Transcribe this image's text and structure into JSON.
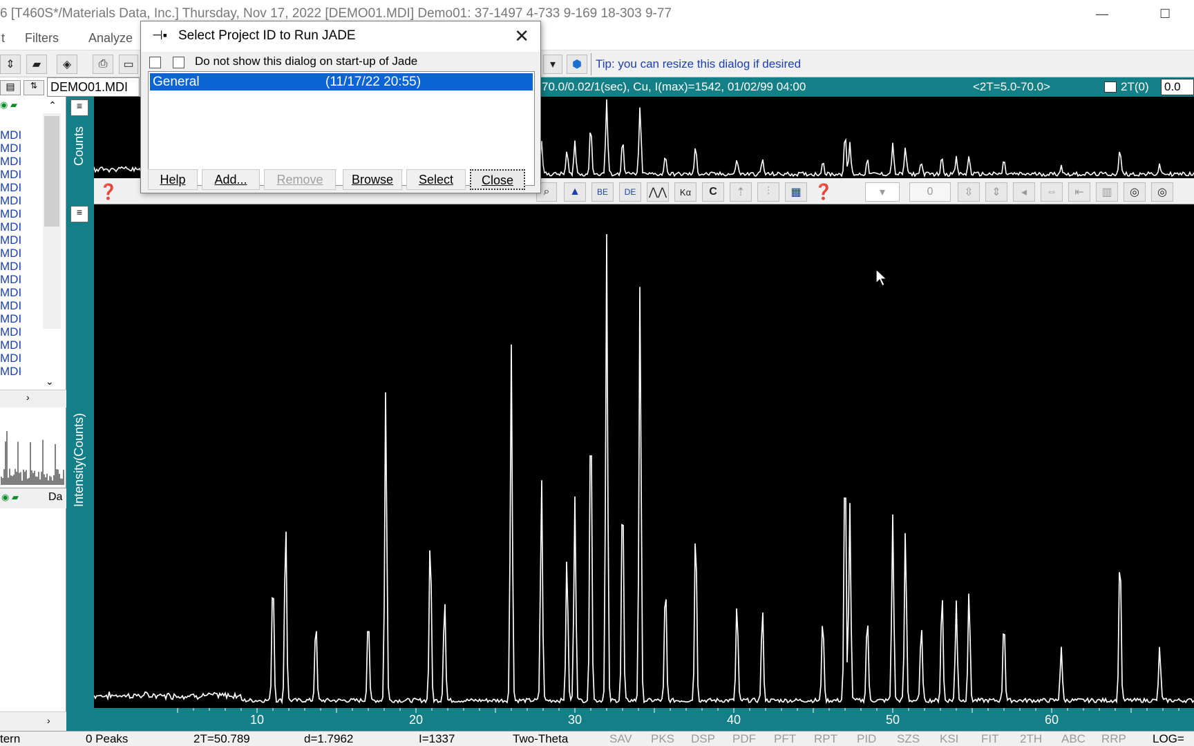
{
  "window": {
    "title": "6 [T460S*/Materials Data, Inc.] Thursday, Nov 17, 2022 [DEMO01.MDI] Demo01: 37-1497 4-733 9-169 18-303 9-77"
  },
  "menu": {
    "items": [
      "t",
      "Filters",
      "Analyze"
    ]
  },
  "toolbar": {
    "tip": "Tip: you can resize this dialog if desired"
  },
  "left_panel": {
    "file": "DEMO01.MDI",
    "items": [
      "MDI",
      "MDI",
      "MDI",
      "MDI",
      "MDI",
      "MDI",
      "MDI",
      "MDI",
      "MDI",
      "MDI",
      "MDI",
      "MDI",
      "MDI",
      "MDI",
      "MDI",
      "MDI",
      "MDI",
      "MDI",
      "MDI"
    ],
    "da_label": "Da"
  },
  "info_bar": {
    "scan": "70.0/0.02/1(sec), Cu, I(max)=1542, 01/02/99 04:00",
    "range": "<2T=5.0-70.0>",
    "offset_label": "2T(0)",
    "offset_value": "0.0"
  },
  "plot": {
    "top_ylabel": "Counts",
    "main_ylabel": "Intensity(Counts)",
    "x_ticks": [
      "10",
      "20",
      "30",
      "40",
      "50",
      "60"
    ],
    "stepper_value": "0"
  },
  "chart_data": {
    "type": "line",
    "xlabel": "",
    "ylabel": "Intensity(Counts)",
    "xlim": [
      5,
      70
    ],
    "ylim": [
      0,
      1600
    ],
    "peaks": [
      [
        11.0,
        430
      ],
      [
        11.8,
        610
      ],
      [
        13.7,
        270
      ],
      [
        17.0,
        290
      ],
      [
        18.1,
        1040
      ],
      [
        20.9,
        560
      ],
      [
        21.8,
        350
      ],
      [
        26.0,
        1180
      ],
      [
        27.9,
        740
      ],
      [
        29.5,
        480
      ],
      [
        30.0,
        680
      ],
      [
        31.0,
        1030
      ],
      [
        32.0,
        1540
      ],
      [
        33.0,
        730
      ],
      [
        34.1,
        1400
      ],
      [
        35.7,
        400
      ],
      [
        37.6,
        600
      ],
      [
        40.2,
        330
      ],
      [
        41.8,
        310
      ],
      [
        45.6,
        290
      ],
      [
        47.0,
        840
      ],
      [
        47.3,
        660
      ],
      [
        48.4,
        290
      ],
      [
        50.0,
        620
      ],
      [
        50.8,
        570
      ],
      [
        51.8,
        260
      ],
      [
        53.1,
        370
      ],
      [
        54.0,
        330
      ],
      [
        54.8,
        370
      ],
      [
        57.0,
        280
      ],
      [
        60.6,
        180
      ],
      [
        64.3,
        520
      ],
      [
        66.8,
        180
      ]
    ]
  },
  "dialog": {
    "title": "Select Project ID to Run JADE",
    "checkbox_label": "Do not show this dialog on start-up of Jade",
    "list": [
      {
        "name": "General",
        "date": "(11/17/22 20:55)"
      }
    ],
    "buttons": {
      "help": "Help",
      "add": "Add...",
      "remove": "Remove",
      "browse": "Browse",
      "select": "Select",
      "close": "Close"
    }
  },
  "status": {
    "mode": "tern",
    "peaks": "0 Peaks",
    "two_theta": "2T=50.789",
    "d_spacing": "d=1.7962",
    "intensity": "I=1337",
    "axis": "Two-Theta",
    "buttons": [
      "SAV",
      "PKS",
      "DSP",
      "PDF",
      "PFT",
      "RPT",
      "PID",
      "SZS",
      "KSI",
      "FIT",
      "2TH",
      "ABC",
      "RRP"
    ],
    "scale": "LOG="
  }
}
